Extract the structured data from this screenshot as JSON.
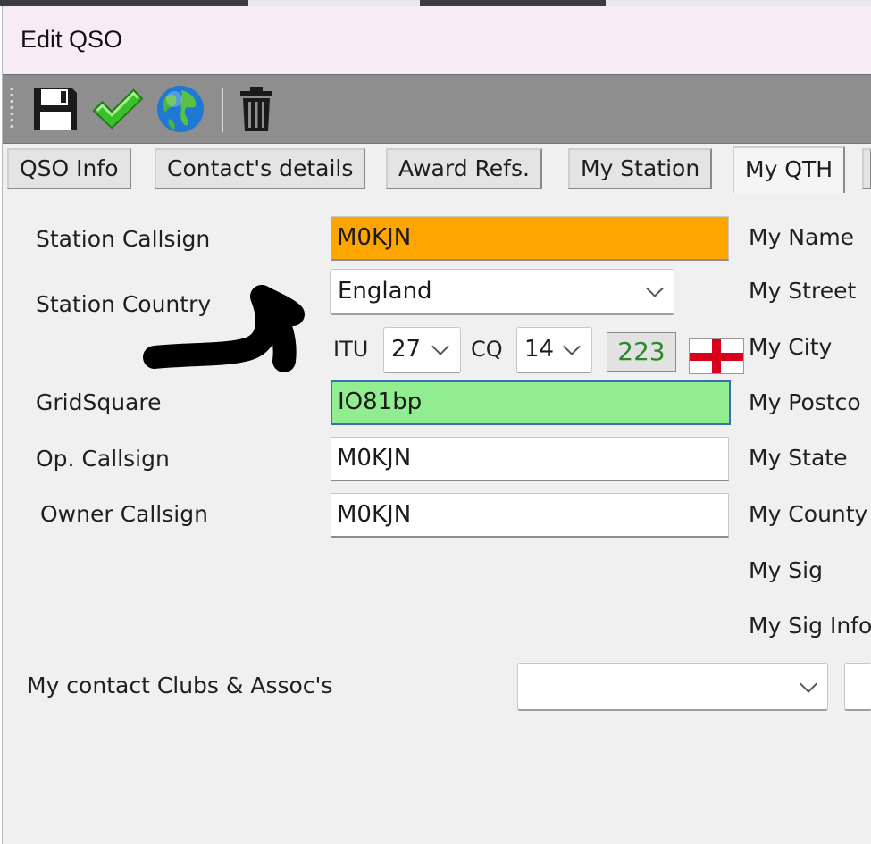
{
  "window": {
    "title": "Edit QSO"
  },
  "toolbar": {
    "buttons": [
      {
        "icon": "save-icon"
      },
      {
        "icon": "checkmark-icon"
      },
      {
        "icon": "globe-icon"
      },
      {
        "icon": "trash-icon"
      }
    ]
  },
  "tabs": [
    {
      "label": "QSO Info"
    },
    {
      "label": "Contact's details"
    },
    {
      "label": "Award Refs."
    },
    {
      "label": "My Station"
    },
    {
      "label": "My QTH"
    }
  ],
  "form": {
    "station_callsign_label": "Station Callsign",
    "station_callsign_value": "M0KJN",
    "station_callsign_color": "#ffa500",
    "station_country_label": "Station Country",
    "station_country_value": "England",
    "itu_label": "ITU",
    "itu_value": "27",
    "cq_label": "CQ",
    "cq_value": "14",
    "dxcc_value": "223",
    "gridsquare_label": "GridSquare",
    "gridsquare_value": "IO81bp",
    "gridsquare_color": "#90ee90",
    "op_callsign_label": "Op. Callsign",
    "op_callsign_value": "M0KJN",
    "owner_callsign_label": "Owner Callsign",
    "owner_callsign_value": "M0KJN",
    "clubs_label": "My contact Clubs & Assoc's",
    "clubs_value": ""
  },
  "right_labels": [
    "My Name",
    "My Street",
    "My City",
    "My Postco",
    "My State",
    "My County",
    "My Sig",
    "My Sig Info"
  ]
}
